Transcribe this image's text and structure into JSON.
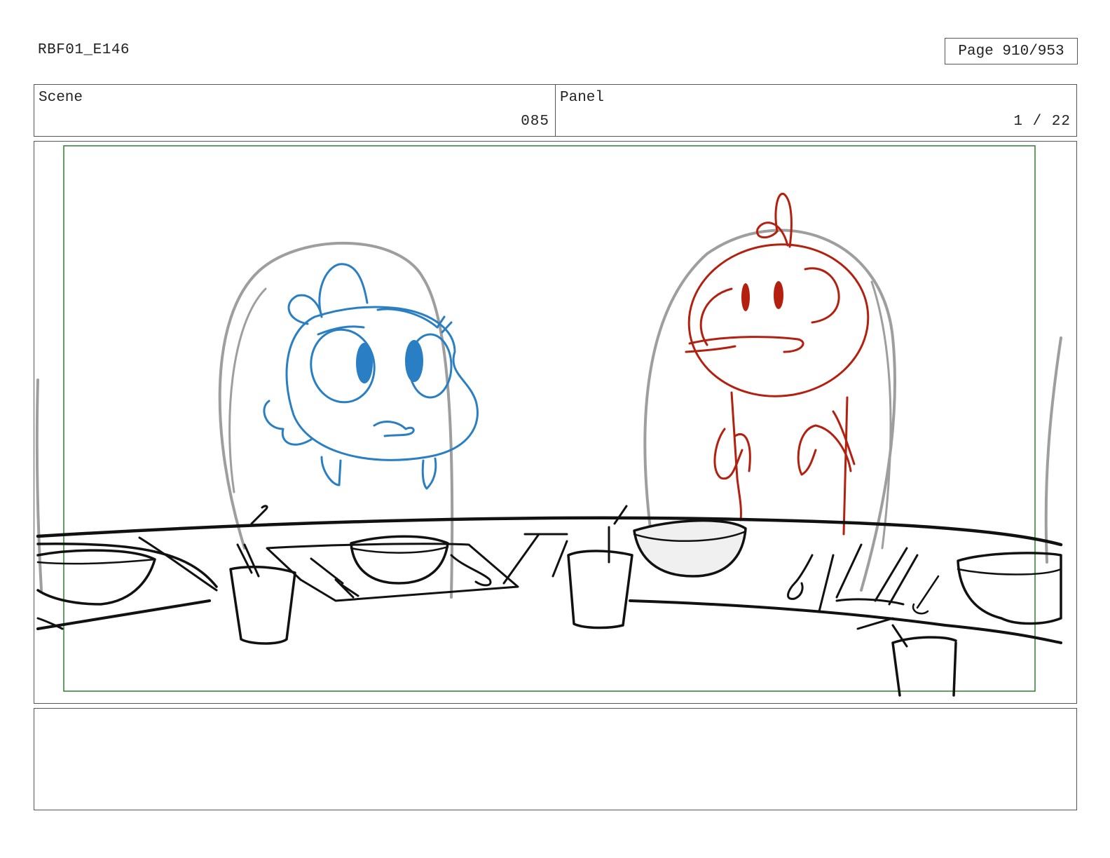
{
  "header": {
    "document_id": "RBF01_E146",
    "page_label": "Page 910/953"
  },
  "info": {
    "scene_label": "Scene",
    "scene_value": "085",
    "panel_label": "Panel",
    "panel_value": "1 / 22"
  },
  "panel_art": {
    "description_colors": {
      "frame_border": "#2e7d32",
      "left_character": "#2a7fc4",
      "right_character": "#b3200f",
      "chairs": "#9e9e9e",
      "props": "#111111"
    }
  },
  "notes": {
    "text": ""
  }
}
